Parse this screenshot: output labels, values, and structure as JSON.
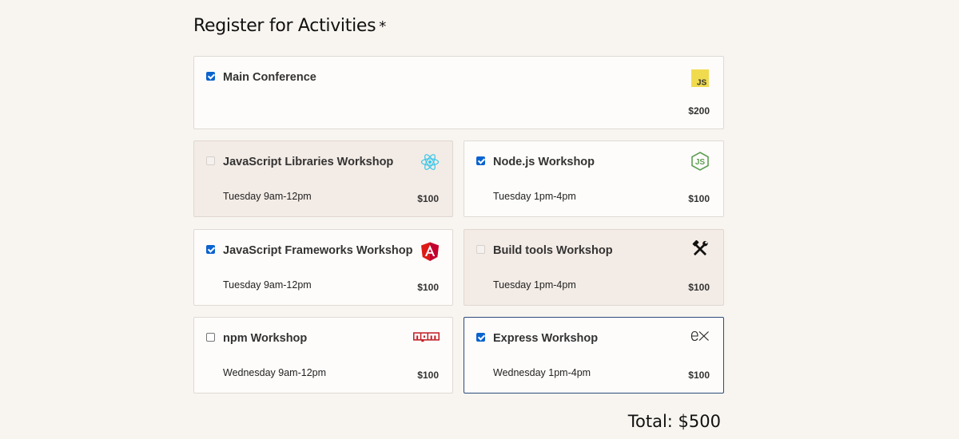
{
  "heading": "Register for Activities",
  "required_marker": "*",
  "activities": [
    {
      "id": "main",
      "name": "Main Conference",
      "time": "",
      "price": "$200",
      "checked": true,
      "disabled": false,
      "logo": "js-icon"
    },
    {
      "id": "js-libs",
      "name": "JavaScript Libraries Workshop",
      "time": "Tuesday 9am-12pm",
      "price": "$100",
      "checked": false,
      "disabled": true,
      "logo": "react-icon"
    },
    {
      "id": "node",
      "name": "Node.js Workshop",
      "time": "Tuesday 1pm-4pm",
      "price": "$100",
      "checked": true,
      "disabled": false,
      "logo": "nodejs-icon"
    },
    {
      "id": "js-frameworks",
      "name": "JavaScript Frameworks Workshop",
      "time": "Tuesday 9am-12pm",
      "price": "$100",
      "checked": true,
      "disabled": false,
      "logo": "angular-icon"
    },
    {
      "id": "build-tools",
      "name": "Build tools Workshop",
      "time": "Tuesday 1pm-4pm",
      "price": "$100",
      "checked": false,
      "disabled": true,
      "logo": "tools-icon"
    },
    {
      "id": "npm",
      "name": "npm Workshop",
      "time": "Wednesday 9am-12pm",
      "price": "$100",
      "checked": false,
      "disabled": false,
      "logo": "npm-icon"
    },
    {
      "id": "express",
      "name": "Express Workshop",
      "time": "Wednesday 1pm-4pm",
      "price": "$100",
      "checked": true,
      "disabled": false,
      "focused": true,
      "logo": "express-icon"
    }
  ],
  "total_text": "Total: $500",
  "colors": {
    "page_background": "#f8f5f0",
    "checkbox_checked": "#0b63cf",
    "disabled_card": "#f3ebe5",
    "focus_border": "#2c4a7c"
  }
}
